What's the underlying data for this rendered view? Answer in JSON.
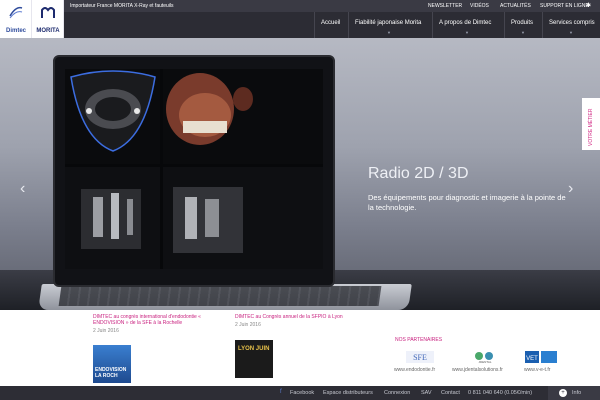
{
  "header": {
    "logos": [
      {
        "name": "Dimtec"
      },
      {
        "name": "MORITA"
      }
    ],
    "tagline": "Importateur France MORITA X-Ray et fauteuils",
    "top_links": [
      "NEWSLETTER",
      "VIDÉOS",
      "ACTUALITÉS",
      "SUPPORT EN LIGNE"
    ],
    "nav": [
      "Accueil",
      "Fiabilité japonaise Morita",
      "A propos de Dimtec",
      "Produits",
      "Services compris"
    ]
  },
  "hero": {
    "title": "Radio 2D / 3D",
    "subtitle": "Des équipements pour diagnostic et imagerie à la pointe de la technologie.",
    "side_tab": "VOTRE MÉTIER"
  },
  "news": [
    {
      "title": "DIMTEC au congrès international d'endodontie « ENDOVISION » de la SFE à la Rochelle",
      "date": "2 Juin 2016",
      "thumb_label": "ENDOVISION LA ROCH"
    },
    {
      "title": "DIMTEC au Congrès annuel de la SFPIO à Lyon",
      "date": "2 Juin 2016",
      "thumb_label": "LYON JUIN"
    }
  ],
  "partners": {
    "label": "NOS PARTENAIRES",
    "items": [
      {
        "logo": "SFE",
        "url": "www.endodontie.fr"
      },
      {
        "logo": "JDENTAL",
        "url": "www.jdentalsolutions.fr"
      },
      {
        "logo": "VET",
        "url": "www.v-e-t.fr"
      }
    ]
  },
  "footer": {
    "links": [
      "Facebook",
      "Espace distributeurs",
      "Connexion",
      "SAV",
      "Contact"
    ],
    "phone": "0 811 040 640 (0.05€/min)",
    "info_label": "Info"
  },
  "colors": {
    "accent": "#c81f7e",
    "nav_bg": "#2c2c34",
    "footer_bg": "#2d2d35"
  }
}
